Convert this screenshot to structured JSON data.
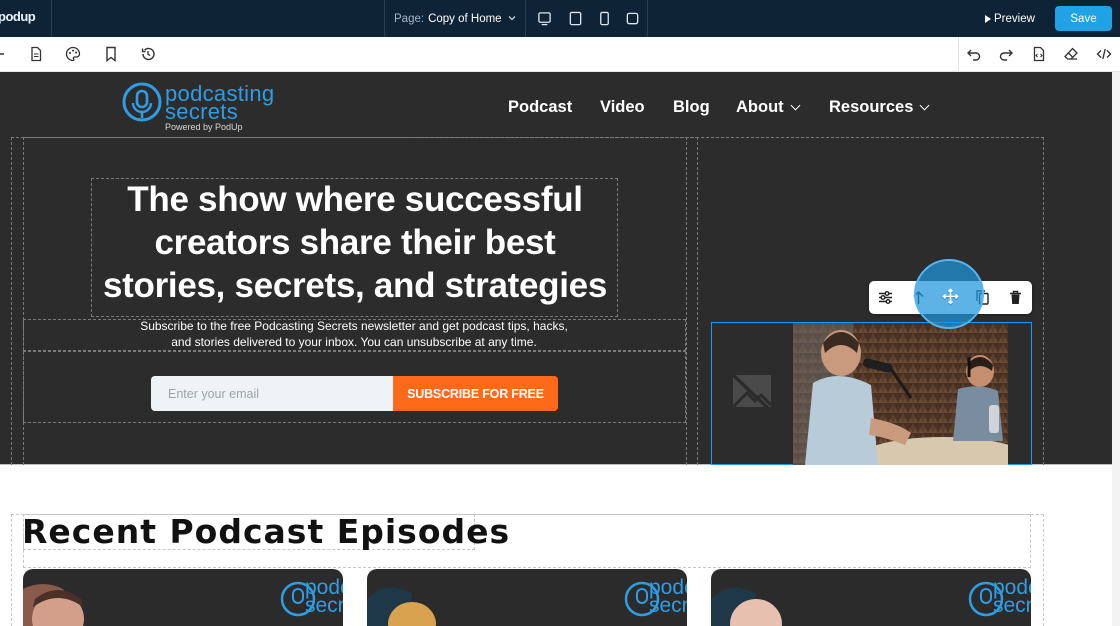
{
  "editor": {
    "logo_text": "podup",
    "logo_subtext": "Podcast Built Differently",
    "page_label": "Page:",
    "page_value": "Copy of Home",
    "preview_label": "Preview",
    "save_label": "Save",
    "accent_color": "#1fa3e4"
  },
  "site": {
    "brand_line1": "podcasting",
    "brand_line2": "secrets",
    "brand_powered": "Powered by PodUp",
    "nav": [
      "Podcast",
      "Video",
      "Blog",
      "About",
      "Resources"
    ],
    "headline": "The show where successful creators share their best stories, secrets, and strategies",
    "subtext_line1": "Subscribe to the free Podcasting Secrets newsletter and get podcast tips, hacks,",
    "subtext_line2": "and stories delivered to your inbox. You can unsubscribe at any time.",
    "email_placeholder": "Enter your email",
    "subscribe_label": "SUBSCRIBE FOR FREE",
    "subscribe_color": "#ff6a1a",
    "recent_title": "Recent Podcast Episodes",
    "card_brand": "podc secre"
  }
}
